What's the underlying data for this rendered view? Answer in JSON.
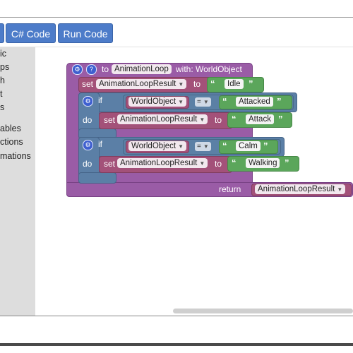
{
  "toolbar": {
    "csharp_label": "C# Code",
    "run_label": "Run Code"
  },
  "toolbox": {
    "items": [
      "ic",
      "ps",
      "h",
      "t",
      "s",
      "ables",
      "ctions",
      "mations"
    ]
  },
  "colors": {
    "button": "#4d7cc9",
    "procedure": "#9a5ca6",
    "variable_set": "#a35179",
    "logic_if": "#5b7fa6",
    "text": "#5ba65b"
  },
  "blocks": {
    "proc_to": "to",
    "proc_name": "AnimationLoop",
    "proc_with": "with: WorldObject",
    "set1_kw": "set",
    "set1_var": "AnimationLoopResult",
    "set1_to": "to",
    "set1_val": "Idle",
    "if1_kw": "if",
    "if1_var": "WorldObject",
    "if1_op": "=",
    "if1_val": "Attacked",
    "do1_kw": "do",
    "set2_kw": "set",
    "set2_var": "AnimationLoopResult",
    "set2_to": "to",
    "set2_val": "Attack",
    "if2_kw": "if",
    "if2_var": "WorldObject",
    "if2_op": "=",
    "if2_val": "Calm",
    "do2_kw": "do",
    "set3_kw": "set",
    "set3_var": "AnimationLoopResult",
    "set3_to": "to",
    "set3_val": "Walking",
    "return_kw": "return",
    "return_var": "AnimationLoopResult",
    "quote_open": "“",
    "quote_close": "”"
  }
}
